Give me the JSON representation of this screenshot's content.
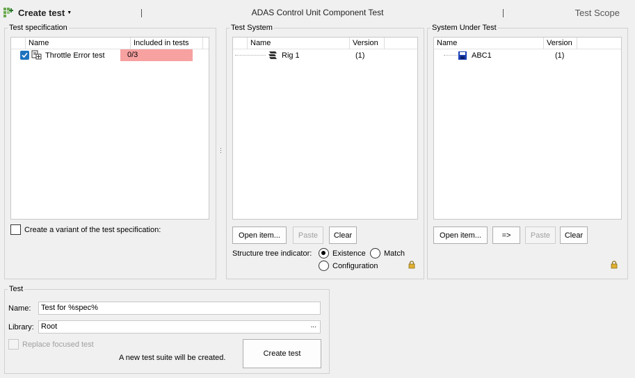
{
  "toolbar": {
    "create_label": "Create test",
    "title": "ADAS Control Unit Component Test",
    "scope": "Test Scope"
  },
  "test_spec": {
    "title": "Test specification",
    "columns": [
      "Name",
      "Included in tests"
    ],
    "rows": [
      {
        "name": "Throttle Error test",
        "included": "0/3",
        "checked": true
      }
    ],
    "variant_label": "Create a variant of the test specification:"
  },
  "test_system": {
    "title": "Test System",
    "columns": [
      "Name",
      "Version"
    ],
    "rows": [
      {
        "name": "Rig 1",
        "version": "(1)"
      }
    ],
    "buttons": {
      "open": "Open item...",
      "paste": "Paste",
      "clear": "Clear"
    },
    "structure_label": "Structure tree indicator:",
    "options": [
      "Existence",
      "Match",
      "Configuration"
    ],
    "selected": "Existence"
  },
  "sut": {
    "title": "System Under Test",
    "columns": [
      "Name",
      "Version"
    ],
    "rows": [
      {
        "name": "ABC1",
        "version": "(1)"
      }
    ],
    "buttons": {
      "open": "Open item...",
      "arrow": "=>",
      "paste": "Paste",
      "clear": "Clear"
    }
  },
  "test": {
    "title": "Test",
    "name_label": "Name:",
    "name_value": "Test for %spec%",
    "library_label": "Library:",
    "library_value": "Root",
    "library_browse": "...",
    "replace_label": "Replace focused test",
    "info": "A new test suite will be created.",
    "create_button": "Create test"
  },
  "colors": {
    "included_bg": "#f7a1a1",
    "accent": "#1e73be"
  }
}
